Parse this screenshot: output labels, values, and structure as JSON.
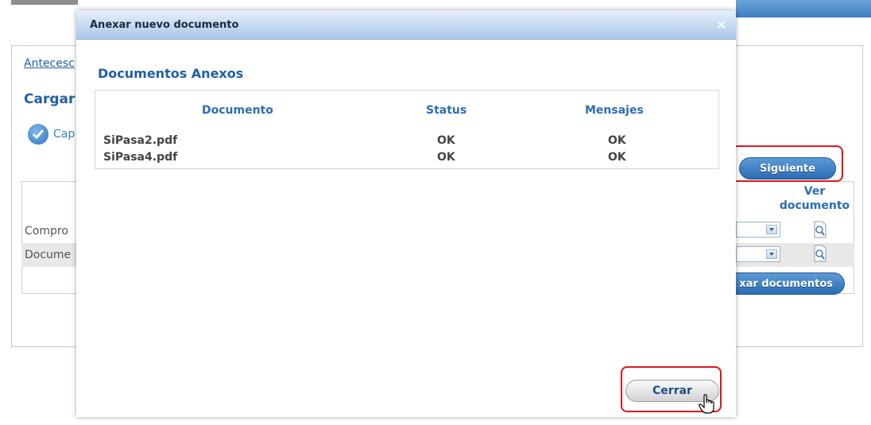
{
  "background": {
    "breadcrumb_link": "Antecesc",
    "heading": "Cargar",
    "step_label": "Cap",
    "ver_documento_header": "Ver documento",
    "rows": [
      "Compro",
      "Docume"
    ],
    "next_button": "Siguiente",
    "attach_button": "xar documentos"
  },
  "modal": {
    "title": "Anexar nuevo documento",
    "close_glyph": "×",
    "section_title": "Documentos Anexos",
    "table": {
      "headers": [
        "Documento",
        "Status",
        "Mensajes"
      ],
      "rows": [
        {
          "documento": "SiPasa2.pdf",
          "status": "OK",
          "mensajes": "OK"
        },
        {
          "documento": "SiPasa4.pdf",
          "status": "OK",
          "mensajes": "OK"
        }
      ]
    },
    "close_button": "Cerrar"
  },
  "colors": {
    "accent": "#1f5fa8",
    "highlight": "#e0161c",
    "titlebar": "#a9c8e8"
  }
}
